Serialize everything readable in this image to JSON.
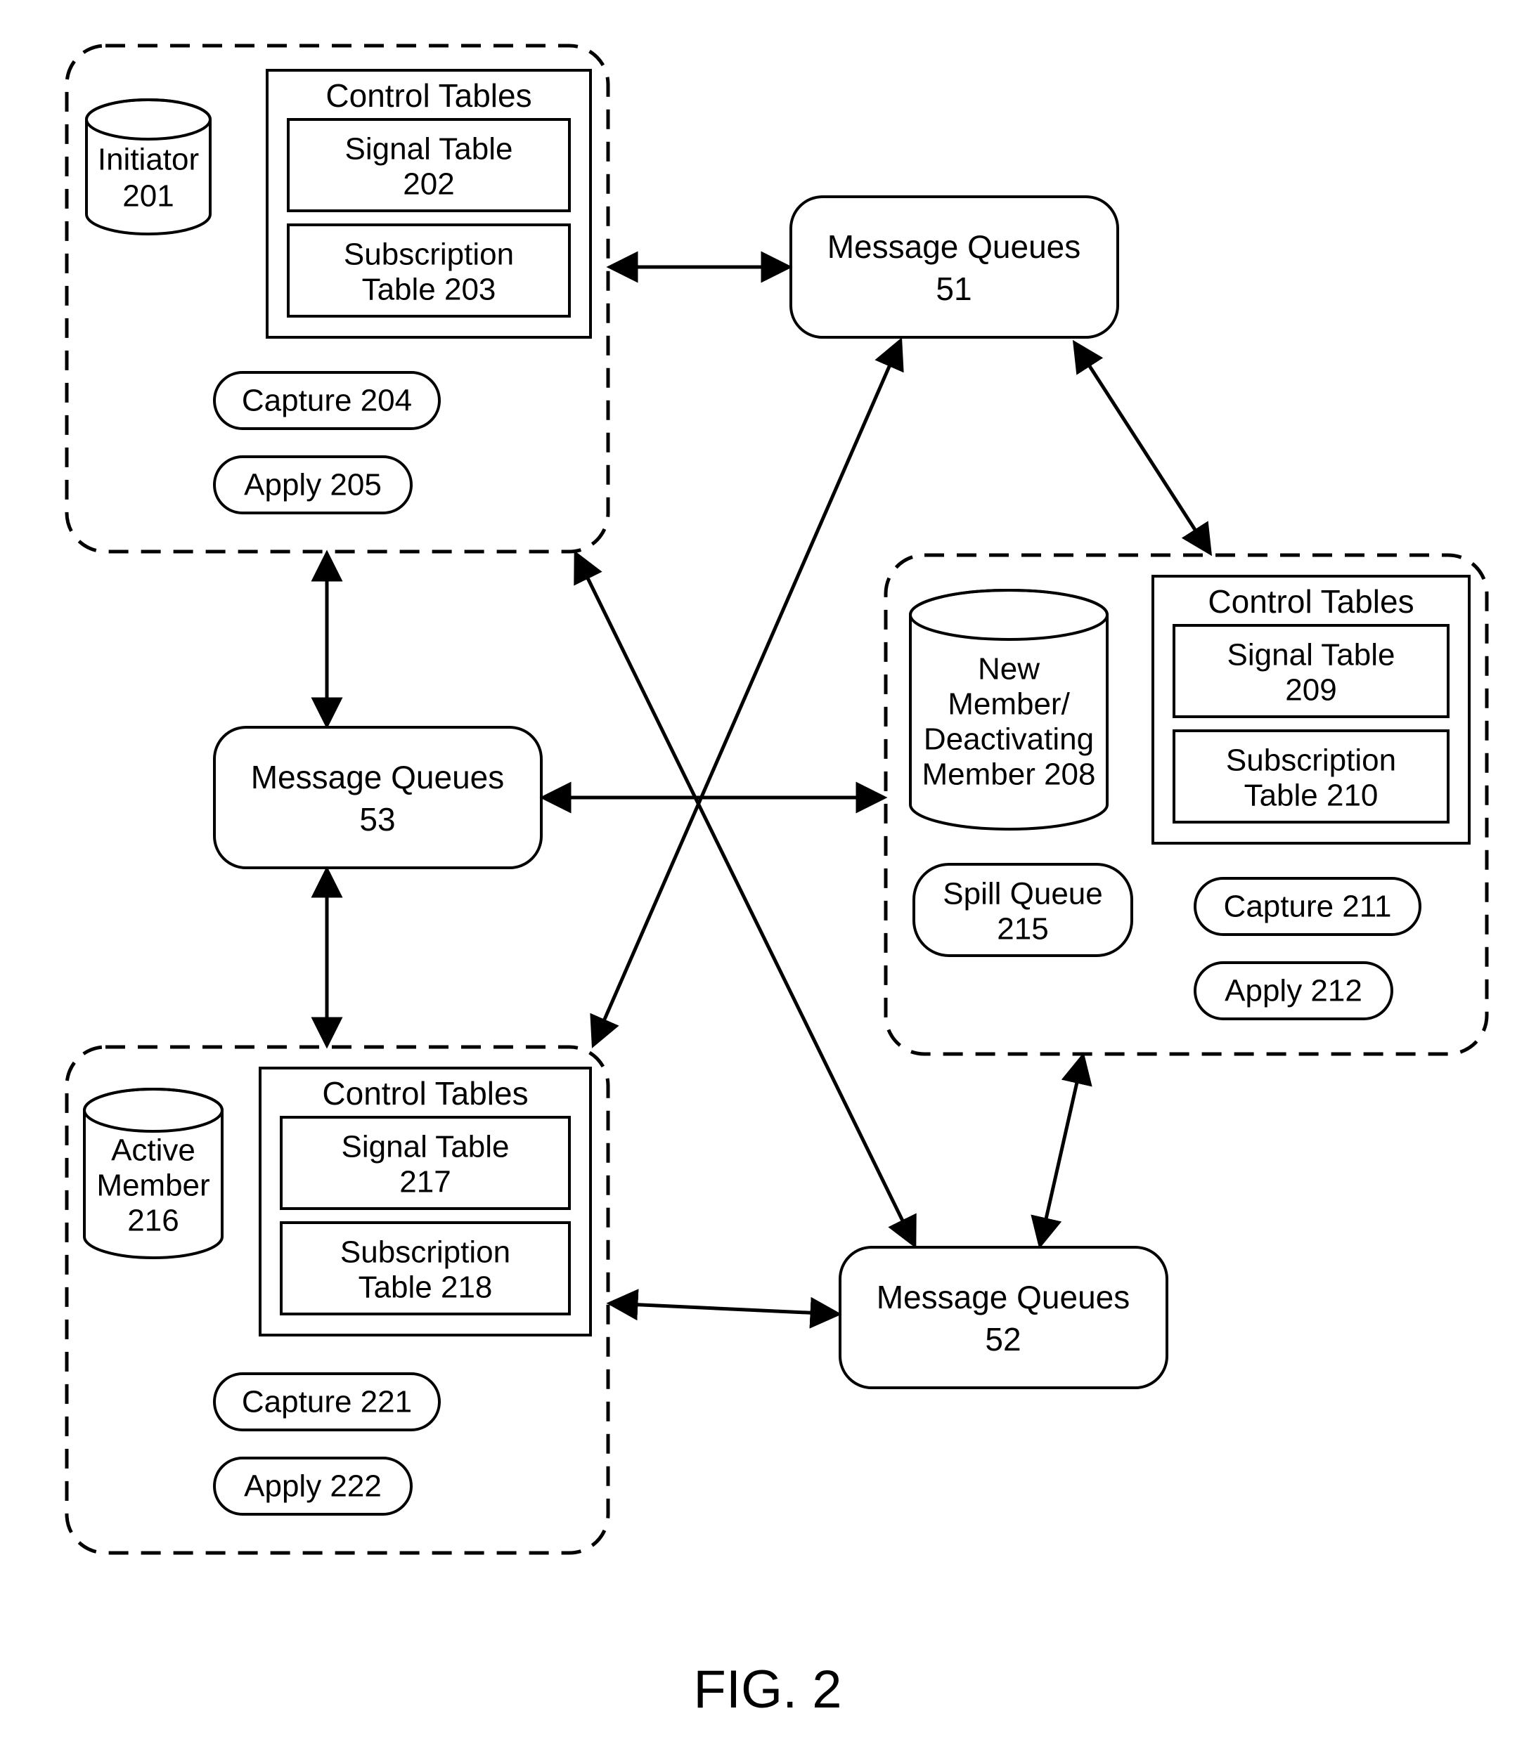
{
  "figure_label": "FIG. 2",
  "nodes": {
    "initiator": {
      "line1": "Initiator",
      "line2": "201"
    },
    "active_member": {
      "line1": "Active",
      "line2": "Member",
      "line3": "216"
    },
    "new_member": {
      "line1": "New",
      "line2": "Member/",
      "line3": "Deactivating",
      "line4": "Member 208"
    },
    "mq51": {
      "line1": "Message Queues",
      "line2": "51"
    },
    "mq52": {
      "line1": "Message Queues",
      "line2": "52"
    },
    "mq53": {
      "line1": "Message Queues",
      "line2": "53"
    }
  },
  "group_top": {
    "control_label": "Control Tables",
    "signal": {
      "line1": "Signal Table",
      "line2": "202"
    },
    "subscription": {
      "line1": "Subscription",
      "line2": "Table 203"
    },
    "capture": "Capture 204",
    "apply": "Apply 205"
  },
  "group_right": {
    "control_label": "Control Tables",
    "signal": {
      "line1": "Signal Table",
      "line2": "209"
    },
    "subscription": {
      "line1": "Subscription",
      "line2": "Table 210"
    },
    "spill": {
      "line1": "Spill Queue",
      "line2": "215"
    },
    "capture": "Capture 211",
    "apply": "Apply 212"
  },
  "group_bottom": {
    "control_label": "Control Tables",
    "signal": {
      "line1": "Signal Table",
      "line2": "217"
    },
    "subscription": {
      "line1": "Subscription",
      "line2": "Table 218"
    },
    "capture": "Capture 221",
    "apply": "Apply 222"
  }
}
